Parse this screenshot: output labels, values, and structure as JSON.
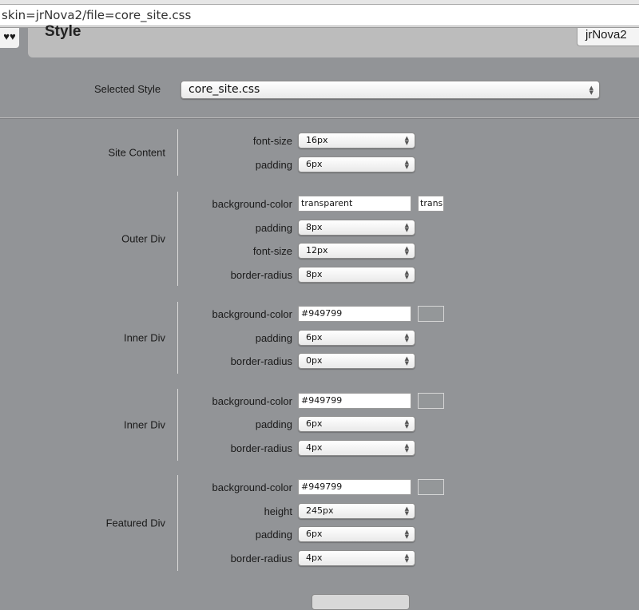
{
  "browser": {
    "url": "skin=jrNova2/file=core_site.css"
  },
  "header": {
    "icon": "♥♥",
    "title": "Style",
    "skin": "jrNova2"
  },
  "selected_style": {
    "label": "Selected Style",
    "value": "core_site.css"
  },
  "groups": [
    {
      "label": "Site Content",
      "rows": [
        {
          "label": "font-size",
          "type": "select",
          "value": "16px"
        },
        {
          "label": "padding",
          "type": "select",
          "value": "6px"
        }
      ]
    },
    {
      "label": "Outer Div",
      "rows": [
        {
          "label": "background-color",
          "type": "color",
          "value": "transparent",
          "swatch_text": "trans"
        },
        {
          "label": "padding",
          "type": "select",
          "value": "8px"
        },
        {
          "label": "font-size",
          "type": "select",
          "value": "12px"
        },
        {
          "label": "border-radius",
          "type": "select",
          "value": "8px"
        }
      ]
    },
    {
      "label": "Inner Div",
      "rows": [
        {
          "label": "background-color",
          "type": "color",
          "value": "#949799"
        },
        {
          "label": "padding",
          "type": "select",
          "value": "6px"
        },
        {
          "label": "border-radius",
          "type": "select",
          "value": "0px"
        }
      ]
    },
    {
      "label": "Inner Div",
      "rows": [
        {
          "label": "background-color",
          "type": "color",
          "value": "#949799"
        },
        {
          "label": "padding",
          "type": "select",
          "value": "6px"
        },
        {
          "label": "border-radius",
          "type": "select",
          "value": "4px"
        }
      ]
    },
    {
      "label": "Featured Div",
      "rows": [
        {
          "label": "background-color",
          "type": "color",
          "value": "#949799"
        },
        {
          "label": "height",
          "type": "select",
          "value": "245px"
        },
        {
          "label": "padding",
          "type": "select",
          "value": "6px"
        },
        {
          "label": "border-radius",
          "type": "select",
          "value": "4px"
        }
      ]
    }
  ]
}
